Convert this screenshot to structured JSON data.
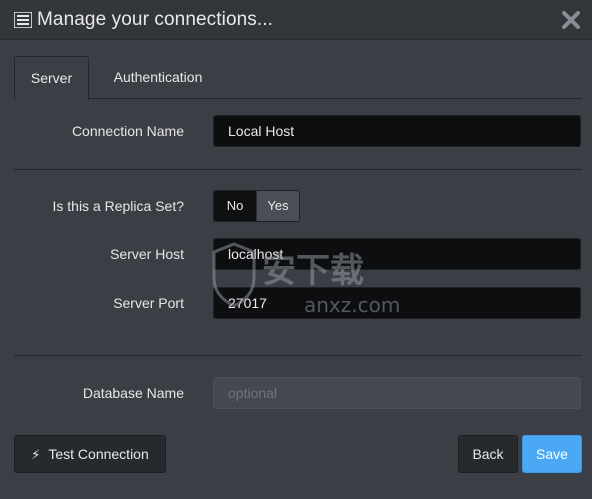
{
  "window": {
    "title": "Manage your connections...",
    "menu_icon": "menu-icon",
    "close_icon": "close-icon"
  },
  "tabs": [
    {
      "label": "Server",
      "active": true
    },
    {
      "label": "Authentication",
      "active": false
    }
  ],
  "form": {
    "connection_name_label": "Connection Name",
    "connection_name_value": "Local Host",
    "replica_label": "Is this a Replica Set?",
    "replica_options": [
      "No",
      "Yes"
    ],
    "replica_selected": "No",
    "server_host_label": "Server Host",
    "server_host_value": "localhost",
    "server_port_label": "Server Port",
    "server_port_value": "27017",
    "database_name_label": "Database Name",
    "database_name_placeholder": "optional"
  },
  "buttons": {
    "test_connection": "Test Connection",
    "test_icon": "bolt-icon",
    "back": "Back",
    "save": "Save"
  },
  "watermark": {
    "text_cn": "安下载",
    "text_url": "anxz.com"
  },
  "colors": {
    "accent": "#4aa8f5",
    "background": "#3b3f45",
    "input_bg": "#0d0e10"
  }
}
